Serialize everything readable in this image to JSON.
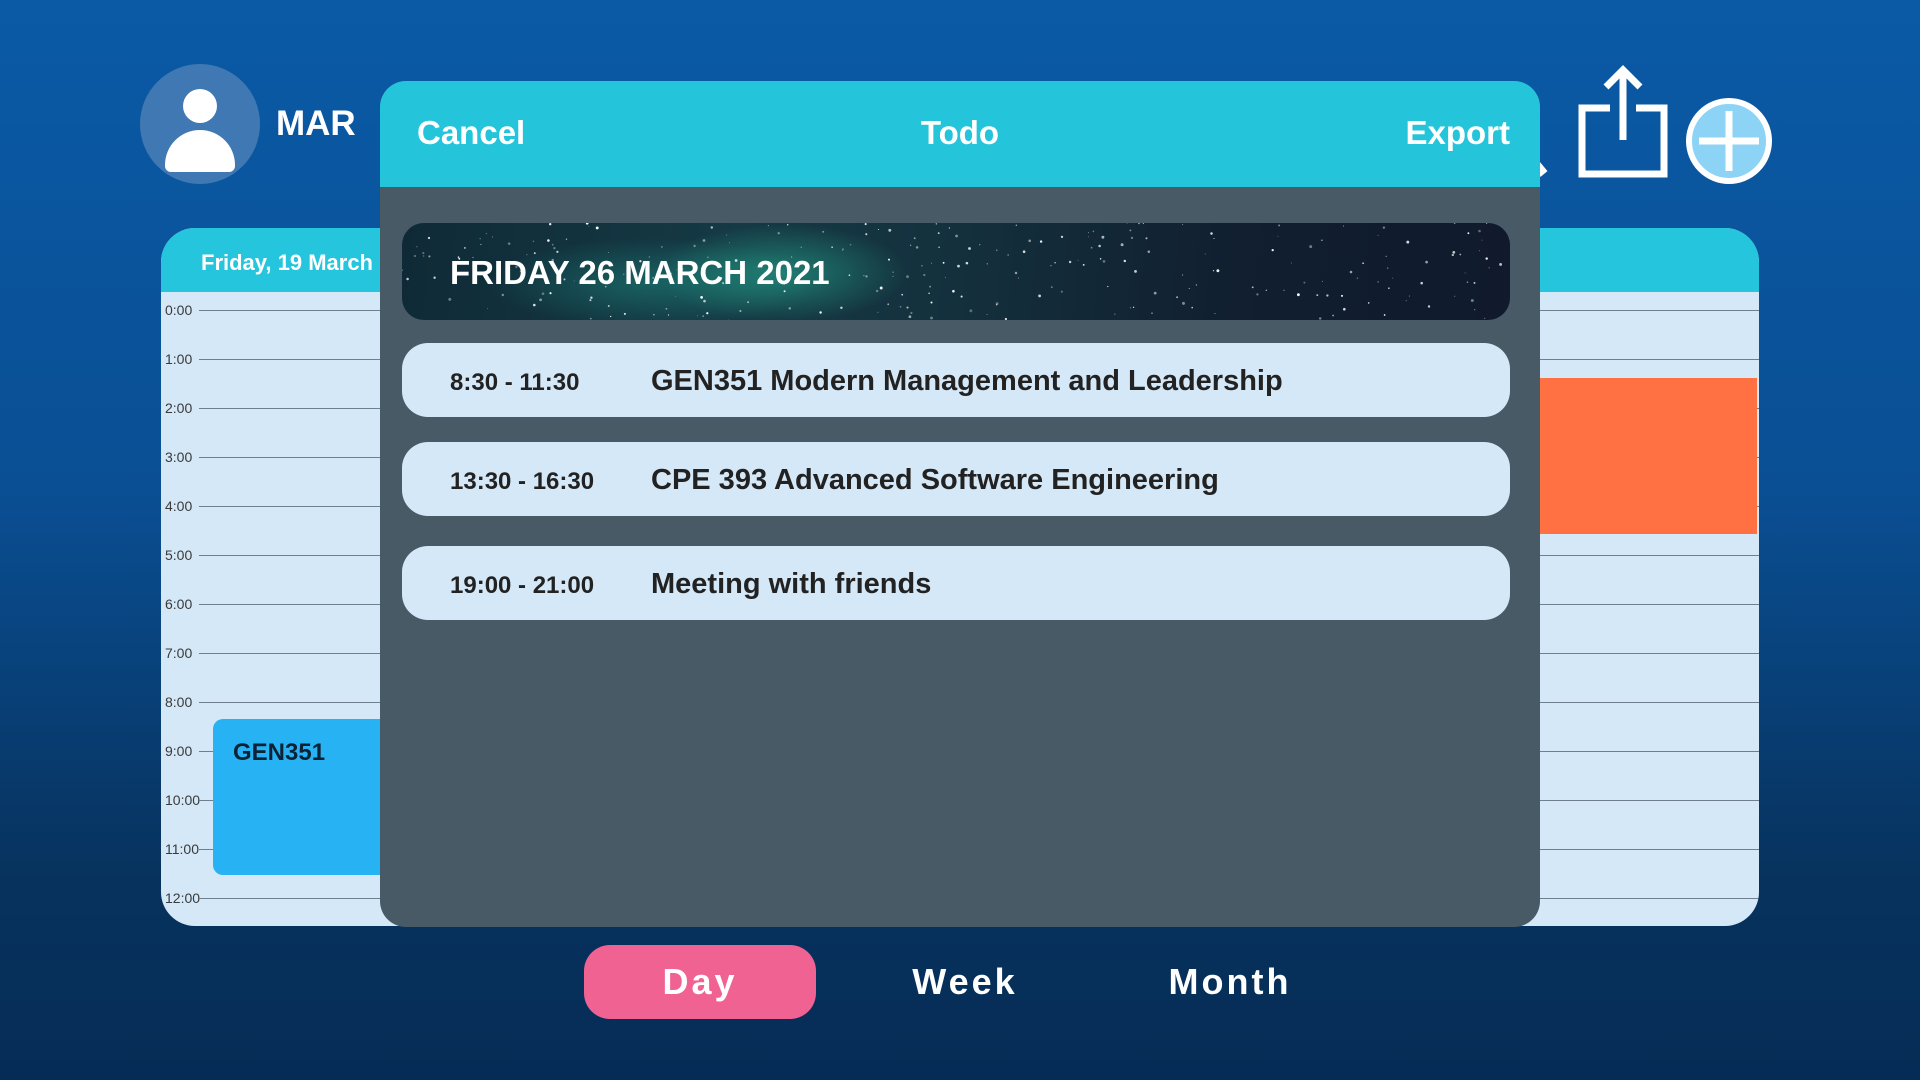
{
  "header": {
    "month": "MAR"
  },
  "icons": {
    "avatar": "user-avatar-icon",
    "search": "search-icon",
    "share": "share-export-icon",
    "add": "add-plus-circle-icon"
  },
  "calendar": {
    "date_header": "Friday, 19 March",
    "hours": [
      "0:00",
      "1:00",
      "2:00",
      "3:00",
      "4:00",
      "5:00",
      "6:00",
      "7:00",
      "8:00",
      "9:00",
      "10:00",
      "11:00",
      "12:00"
    ],
    "events": [
      {
        "label": "GEN351"
      }
    ]
  },
  "modal": {
    "cancel_label": "Cancel",
    "title": "Todo",
    "export_label": "Export",
    "date_banner": "FRIDAY 26 MARCH 2021",
    "items": [
      {
        "time": "8:30 - 11:30",
        "title": "GEN351 Modern Management and Leadership"
      },
      {
        "time": "13:30 - 16:30",
        "title": "CPE 393 Advanced Software Engineering"
      },
      {
        "time": "19:00 - 21:00",
        "title": "Meeting with friends"
      }
    ]
  },
  "views": {
    "day": "Day",
    "week": "Week",
    "month": "Month",
    "active": "Day"
  },
  "colors": {
    "accent": "#24c4da",
    "active_tab": "#f06292",
    "event_blue": "#27b3f3",
    "event_orange": "#ff7043",
    "modal_bg": "#475a66",
    "item_bg": "#d5e8f7"
  }
}
